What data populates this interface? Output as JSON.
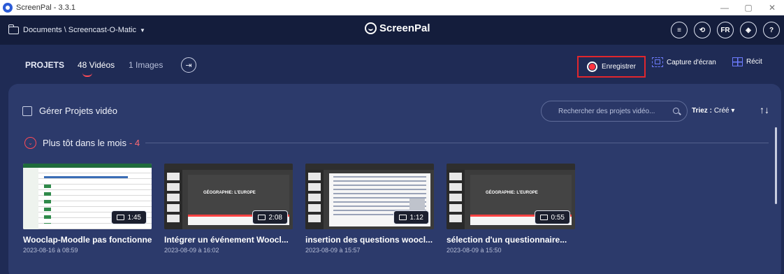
{
  "window": {
    "title": "ScreenPal - 3.3.1",
    "buttons": [
      "—",
      "▢",
      "✕"
    ]
  },
  "header": {
    "path": "Documents \\ Screencast-O-Matic",
    "logo": "ScreenPal",
    "icons": [
      {
        "name": "queue-icon",
        "glyph": "≡"
      },
      {
        "name": "history-icon",
        "glyph": "⟲"
      },
      {
        "name": "language-button",
        "glyph": "FR"
      },
      {
        "name": "layers-icon",
        "glyph": "◈"
      },
      {
        "name": "help-icon",
        "glyph": "?"
      }
    ]
  },
  "tabs": {
    "projects": "PROJETS",
    "videos": "48 Vidéos",
    "images": "1 Images",
    "import_glyph": "⇥"
  },
  "actions": {
    "record": "Enregistrer",
    "capture": "Capture d'écran",
    "story": "Récit"
  },
  "toolbar": {
    "manage_label": "Gérer Projets vidéo",
    "search_placeholder": "Rechercher des projets vidéo...",
    "sort_label": "Triez :",
    "sort_value": "Créé ▾",
    "sort_dir": "↑↓"
  },
  "group": {
    "title": "Plus tôt dans le mois",
    "count": "- 4",
    "toggle": "⌄"
  },
  "videos": [
    {
      "title": "Wooclap-Moodle pas fonctionnel",
      "date": "2023-08-16 à 08:59",
      "duration": "1:45",
      "kind": "sheet",
      "slide_text": ""
    },
    {
      "title": "Intégrer un événement Woocl...",
      "date": "2023-08-09 à 16:02",
      "duration": "2:08",
      "kind": "slide",
      "slide_text": "GÉOGRAPHIE: L'EUROPE"
    },
    {
      "title": "insertion des questions woocl...",
      "date": "2023-08-09 à 15:57",
      "duration": "1:12",
      "kind": "doc",
      "slide_text": ""
    },
    {
      "title": "sélection d'un questionnaire...",
      "date": "2023-08-09 à 15:50",
      "duration": "0:55",
      "kind": "slide",
      "slide_text": "GÉOGRAPHIE: L'EUROPE"
    }
  ]
}
